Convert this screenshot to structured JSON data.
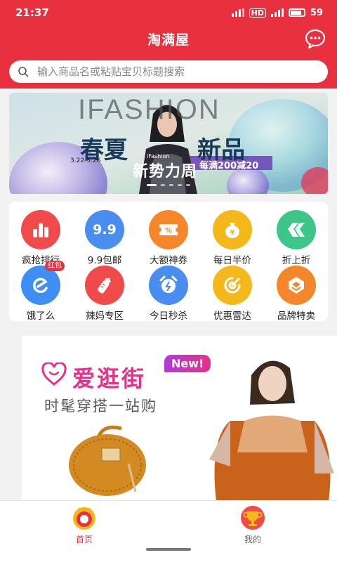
{
  "status": {
    "time": "21:37",
    "battery": "59"
  },
  "header": {
    "title": "淘满屋"
  },
  "search": {
    "placeholder": "输入商品名或粘贴宝贝标题搜索"
  },
  "banner": {
    "brand": "IFASHION",
    "headline_left": "春夏",
    "headline_right": "新品",
    "date_range": "3.22-3.26",
    "small_brand": "iFashion",
    "event_name": "新势力周",
    "promo_text": "每满200减20"
  },
  "categories": [
    {
      "label": "疯抢排行",
      "icon": "trending-bars-icon",
      "color": "#f04a4a"
    },
    {
      "label": "9.9包邮",
      "icon": "price-99-icon",
      "color": "#4a8df0",
      "icon_text": "9.9"
    },
    {
      "label": "大额神券",
      "icon": "coupon-icon",
      "color": "#f5862a"
    },
    {
      "label": "每日半价",
      "icon": "money-bag-icon",
      "color": "#f5b81a"
    },
    {
      "label": "折上折",
      "icon": "discount-tag-icon",
      "color": "#3ec58a"
    },
    {
      "label": "饿了么",
      "icon": "eleme-icon",
      "color": "#3d8ef5",
      "badge": "红包"
    },
    {
      "label": "辣妈专区",
      "icon": "baby-bottle-icon",
      "color": "#f04a4a"
    },
    {
      "label": "今日秒杀",
      "icon": "alarm-clock-icon",
      "color": "#4a8df0"
    },
    {
      "label": "优惠雷达",
      "icon": "radar-icon",
      "color": "#f5b81a"
    },
    {
      "label": "品牌特卖",
      "icon": "brand-badge-icon",
      "color": "#f5862a"
    }
  ],
  "promo": {
    "title": "爱逛街",
    "tag": "New!",
    "subtitle": "时髦穿搭一站购"
  },
  "nav": {
    "home": "首页",
    "mine": "我的"
  },
  "colors": {
    "primary": "#e8303f",
    "promo_pink": "#e8308a"
  }
}
